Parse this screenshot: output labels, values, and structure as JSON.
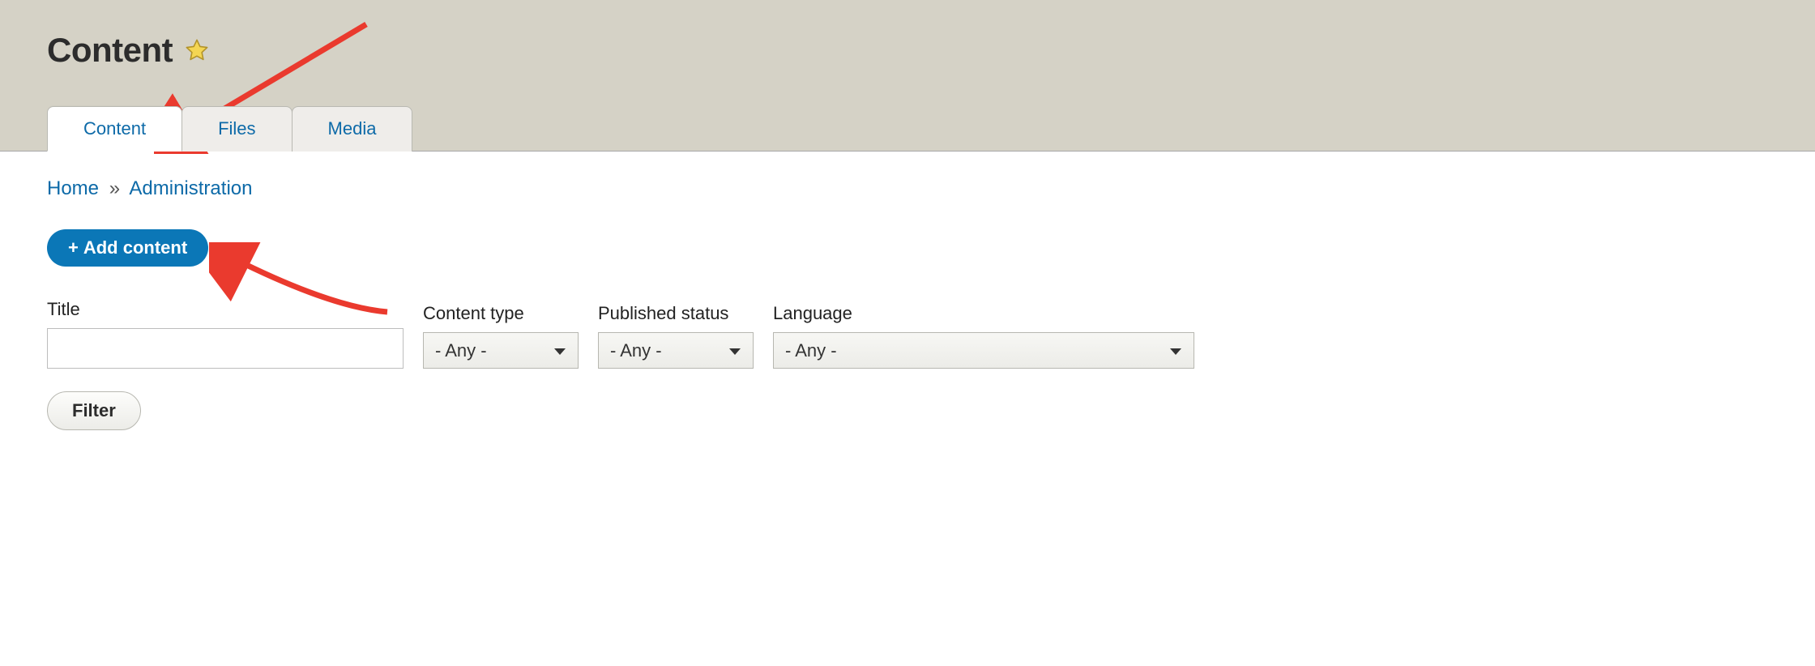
{
  "header": {
    "title": "Content"
  },
  "tabs": [
    {
      "label": "Content",
      "active": true
    },
    {
      "label": "Files",
      "active": false
    },
    {
      "label": "Media",
      "active": false
    }
  ],
  "breadcrumb": {
    "home": "Home",
    "sep": "»",
    "admin": "Administration"
  },
  "add_button": {
    "plus": "+",
    "label": "Add content"
  },
  "filters": {
    "title": {
      "label": "Title",
      "value": ""
    },
    "content_type": {
      "label": "Content type",
      "value": "- Any -"
    },
    "published": {
      "label": "Published status",
      "value": "- Any -"
    },
    "language": {
      "label": "Language",
      "value": "- Any -"
    }
  },
  "filter_button": "Filter",
  "colors": {
    "header_bg": "#d5d2c6",
    "link": "#0d6aa8",
    "primary_btn": "#0b77b7",
    "annotation": "#ea3a2e",
    "star_fill": "#f4d653",
    "star_stroke": "#b2932a"
  }
}
